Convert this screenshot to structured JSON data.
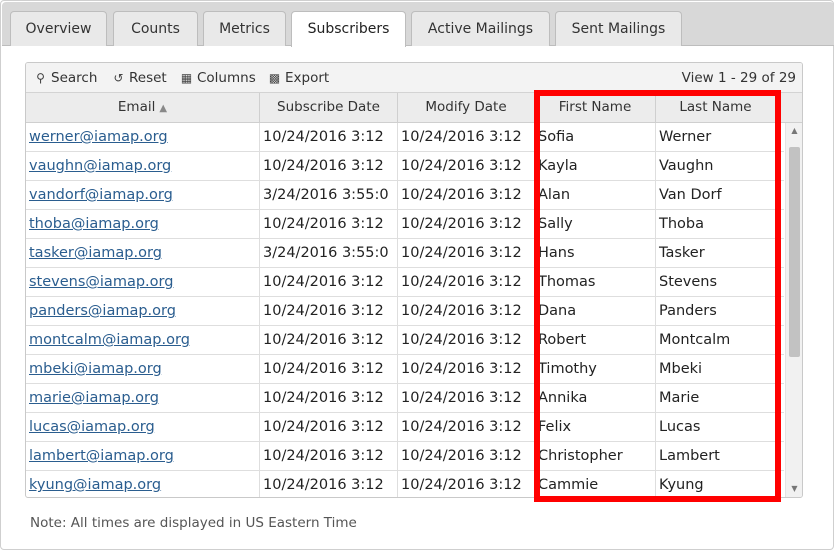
{
  "tabs": [
    {
      "label": "Overview"
    },
    {
      "label": "Counts"
    },
    {
      "label": "Metrics"
    },
    {
      "label": "Subscribers"
    },
    {
      "label": "Active Mailings"
    },
    {
      "label": "Sent Mailings"
    }
  ],
  "active_tab": "Subscribers",
  "toolbar": {
    "search_label": "Search",
    "reset_label": "Reset",
    "columns_label": "Columns",
    "export_label": "Export",
    "view_info": "View 1 - 29 of 29"
  },
  "columns": [
    "Email",
    "Subscribe Date",
    "Modify Date",
    "First Name",
    "Last Name"
  ],
  "rows": [
    {
      "email": "werner@iamap.org",
      "subscribe": "10/24/2016 3:12",
      "modify": "10/24/2016 3:12",
      "first": "Sofia",
      "last": "Werner"
    },
    {
      "email": "vaughn@iamap.org",
      "subscribe": "10/24/2016 3:12",
      "modify": "10/24/2016 3:12",
      "first": "Kayla",
      "last": "Vaughn"
    },
    {
      "email": "vandorf@iamap.org",
      "subscribe": "3/24/2016 3:55:0",
      "modify": "10/24/2016 3:12",
      "first": "Alan",
      "last": "Van Dorf"
    },
    {
      "email": "thoba@iamap.org",
      "subscribe": "10/24/2016 3:12",
      "modify": "10/24/2016 3:12",
      "first": "Sally",
      "last": "Thoba"
    },
    {
      "email": "tasker@iamap.org",
      "subscribe": "3/24/2016 3:55:0",
      "modify": "10/24/2016 3:12",
      "first": "Hans",
      "last": "Tasker"
    },
    {
      "email": "stevens@iamap.org",
      "subscribe": "10/24/2016 3:12",
      "modify": "10/24/2016 3:12",
      "first": "Thomas",
      "last": "Stevens"
    },
    {
      "email": "panders@iamap.org",
      "subscribe": "10/24/2016 3:12",
      "modify": "10/24/2016 3:12",
      "first": "Dana",
      "last": "Panders"
    },
    {
      "email": "montcalm@iamap.org",
      "subscribe": "10/24/2016 3:12",
      "modify": "10/24/2016 3:12",
      "first": "Robert",
      "last": "Montcalm"
    },
    {
      "email": "mbeki@iamap.org",
      "subscribe": "10/24/2016 3:12",
      "modify": "10/24/2016 3:12",
      "first": "Timothy",
      "last": "Mbeki"
    },
    {
      "email": "marie@iamap.org",
      "subscribe": "10/24/2016 3:12",
      "modify": "10/24/2016 3:12",
      "first": "Annika",
      "last": "Marie"
    },
    {
      "email": "lucas@iamap.org",
      "subscribe": "10/24/2016 3:12",
      "modify": "10/24/2016 3:12",
      "first": "Felix",
      "last": "Lucas"
    },
    {
      "email": "lambert@iamap.org",
      "subscribe": "10/24/2016 3:12",
      "modify": "10/24/2016 3:12",
      "first": "Christopher",
      "last": "Lambert"
    },
    {
      "email": "kyung@iamap.org",
      "subscribe": "10/24/2016 3:12",
      "modify": "10/24/2016 3:12",
      "first": "Cammie",
      "last": "Kyung"
    }
  ],
  "note": "Note: All times are displayed in US Eastern Time",
  "colors": {
    "link": "#2a5d8f",
    "highlight": "#ff0000",
    "tabbar": "#d8d8d8"
  },
  "icons": {
    "search": "search-icon",
    "reset": "reset-icon",
    "columns": "columns-icon",
    "export": "export-icon",
    "sort": "sort-icon"
  }
}
